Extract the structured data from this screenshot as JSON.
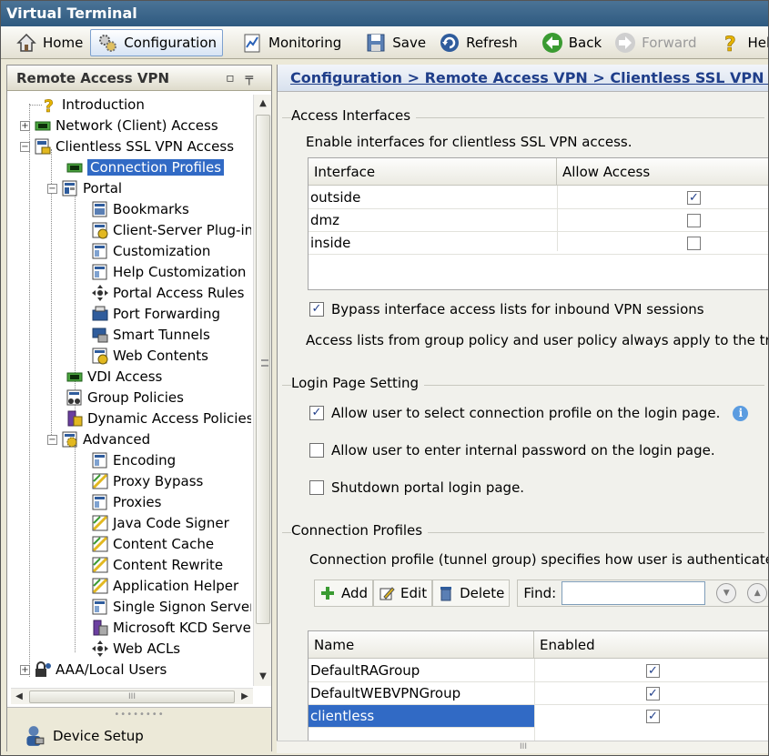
{
  "window": {
    "title": "Virtual Terminal"
  },
  "toolbar": {
    "home": "Home",
    "configuration": "Configuration",
    "monitoring": "Monitoring",
    "save": "Save",
    "refresh": "Refresh",
    "back": "Back",
    "forward": "Forward",
    "help": "Help"
  },
  "left_panel": {
    "title": "Remote Access VPN",
    "tree": {
      "introduction": "Introduction",
      "network_access": "Network (Client) Access",
      "clientless": "Clientless SSL VPN Access",
      "connection_profiles": "Connection Profiles",
      "portal": "Portal",
      "bookmarks": "Bookmarks",
      "client_server_plugins": "Client-Server Plug-ins",
      "customization": "Customization",
      "help_customization": "Help Customization",
      "portal_access_rules": "Portal Access Rules",
      "port_forwarding": "Port Forwarding",
      "smart_tunnels": "Smart Tunnels",
      "web_contents": "Web Contents",
      "vdi_access": "VDI Access",
      "group_policies": "Group Policies",
      "dynamic_access_policies": "Dynamic Access Policies",
      "advanced": "Advanced",
      "encoding": "Encoding",
      "proxy_bypass": "Proxy Bypass",
      "proxies": "Proxies",
      "java_code_signer": "Java Code Signer",
      "content_cache": "Content Cache",
      "content_rewrite": "Content Rewrite",
      "application_helper": "Application Helper",
      "single_signon_servers": "Single Signon Servers",
      "microsoft_kcd_server": "Microsoft KCD Server",
      "web_acls": "Web ACLs",
      "aaa_local_users": "AAA/Local Users"
    },
    "hscroll_grip": "III",
    "device_setup": "Device Setup"
  },
  "breadcrumb": "Configuration > Remote Access VPN > Clientless SSL VPN Access",
  "access_interfaces": {
    "title": "Access Interfaces",
    "description": "Enable interfaces for clientless SSL VPN access.",
    "columns": {
      "interface": "Interface",
      "allow": "Allow Access"
    },
    "rows": [
      {
        "name": "outside",
        "allow": "✓"
      },
      {
        "name": "dmz",
        "allow": ""
      },
      {
        "name": "inside",
        "allow": ""
      }
    ],
    "bypass_checked": "✓",
    "bypass_label": "Bypass interface access lists for inbound VPN sessions",
    "note": "Access lists from group policy and user policy always apply to the traffic."
  },
  "login_page": {
    "title": "Login Page Setting",
    "opt1_checked": "✓",
    "opt1": "Allow user to select connection profile on the login page.",
    "opt2_checked": "",
    "opt2": "Allow user to enter internal password on the login page.",
    "opt3_checked": "",
    "opt3": "Shutdown portal login page."
  },
  "connection_profiles": {
    "title": "Connection Profiles",
    "description": "Connection profile (tunnel group) specifies how user is authenticated and",
    "add": "Add",
    "edit": "Edit",
    "delete": "Delete",
    "find_label": "Find:",
    "find_value": "",
    "columns": {
      "name": "Name",
      "enabled": "Enabled"
    },
    "rows": [
      {
        "name": "DefaultRAGroup",
        "enabled": "✓"
      },
      {
        "name": "DefaultWEBVPNGroup",
        "enabled": "✓"
      },
      {
        "name": "clientless",
        "enabled": "✓"
      }
    ]
  },
  "bottom_grip": "III"
}
